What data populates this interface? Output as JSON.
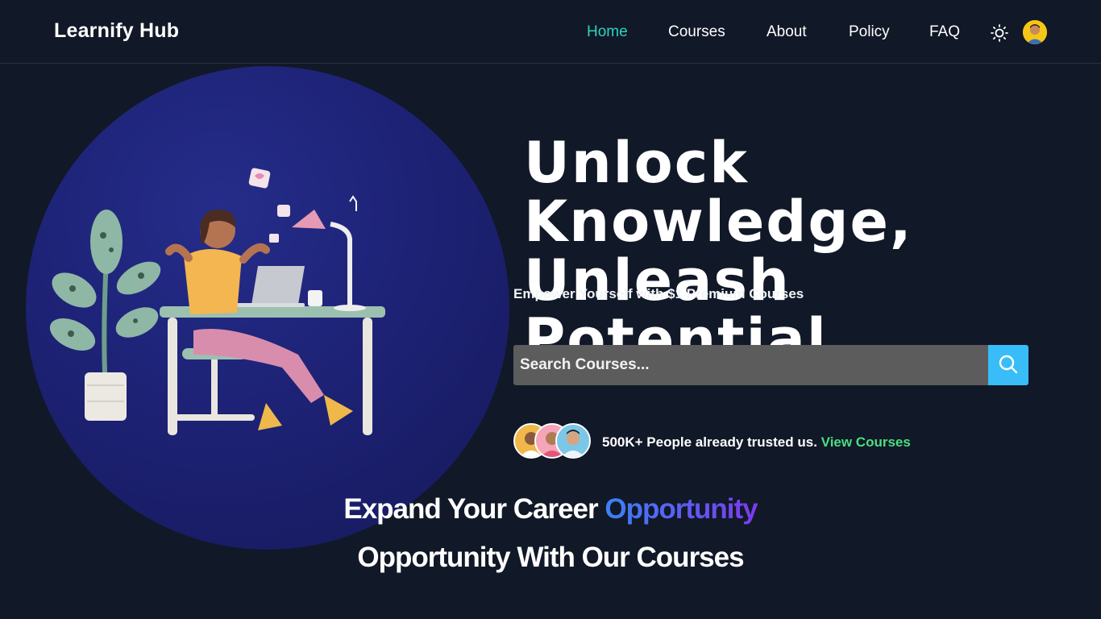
{
  "nav": {
    "brand": "Learnify Hub",
    "links": [
      {
        "label": "Home",
        "active": true
      },
      {
        "label": "Courses",
        "active": false
      },
      {
        "label": "About",
        "active": false
      },
      {
        "label": "Policy",
        "active": false
      },
      {
        "label": "FAQ",
        "active": false
      }
    ],
    "theme_icon": "sun-icon",
    "avatar_icon": "user-avatar"
  },
  "hero": {
    "title_line1": "Unlock Knowledge,",
    "title_line2": "Unleash Potential",
    "subtitle": "Empower Yourself with $1 Premium Courses",
    "search": {
      "placeholder": "Search Courses...",
      "value": "",
      "button_icon": "search-icon"
    },
    "trust": {
      "text": "500K+ People already trusted us.",
      "link": "View Courses"
    }
  },
  "section": {
    "headline_part1": "Expand Your Career",
    "headline_highlight": "Opportunity",
    "headline_line2": "Opportunity With Our Courses"
  },
  "colors": {
    "background": "#111827",
    "active_nav": "#2dd4bf",
    "search_button": "#38bdf8",
    "link_green": "#4ade80",
    "gradient_start": "#3b82f6",
    "gradient_end": "#7c3aed"
  }
}
